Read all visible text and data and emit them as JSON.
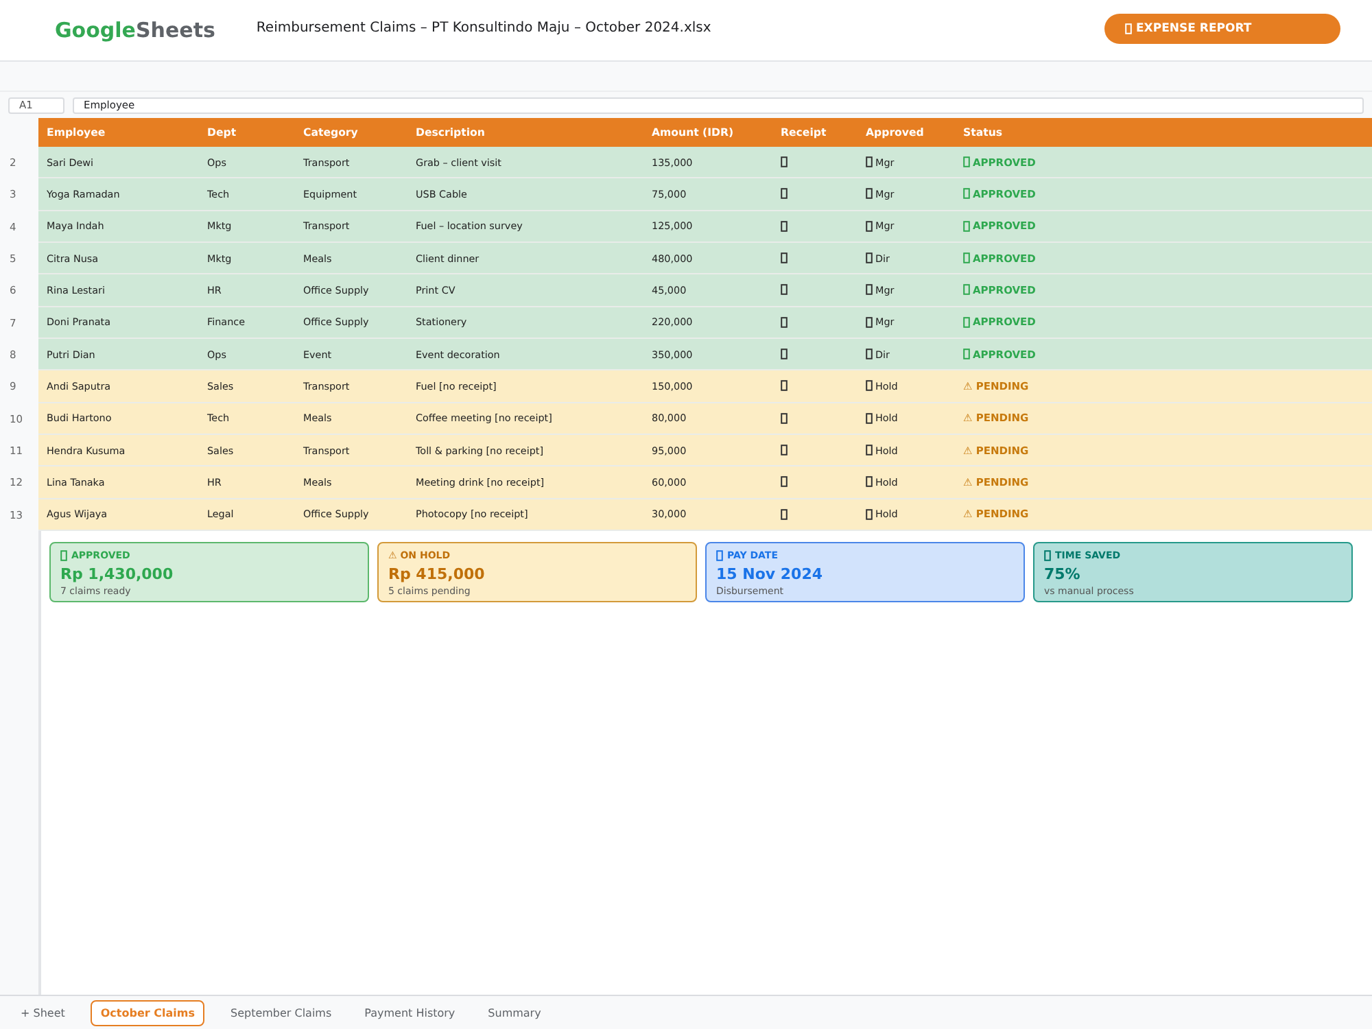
{
  "header": {
    "logo": {
      "brand": "Google",
      "product": "Sheets"
    },
    "file_title": "Reimbursement Claims – PT Konsultindo Maju – October 2024.xlsx",
    "report_button": "EXPENSE REPORT"
  },
  "formula_bar": {
    "cell_ref": "A1",
    "value": "Employee"
  },
  "table": {
    "columns": [
      "Employee",
      "Dept",
      "Category",
      "Description",
      "Amount (IDR)",
      "Receipt",
      "Approved",
      "Status"
    ],
    "rows": [
      {
        "number": "2",
        "kind": "approved",
        "cells": [
          "Sari Dewi",
          "Ops",
          "Transport",
          "Grab – client visit",
          "135,000"
        ],
        "approver": "Mgr",
        "status": "APPROVED"
      },
      {
        "number": "3",
        "kind": "approved",
        "cells": [
          "Yoga Ramadan",
          "Tech",
          "Equipment",
          "USB Cable",
          "75,000"
        ],
        "approver": "Mgr",
        "status": "APPROVED"
      },
      {
        "number": "4",
        "kind": "approved",
        "cells": [
          "Maya Indah",
          "Mktg",
          "Transport",
          "Fuel – location survey",
          "125,000"
        ],
        "approver": "Mgr",
        "status": "APPROVED"
      },
      {
        "number": "5",
        "kind": "approved",
        "cells": [
          "Citra Nusa",
          "Mktg",
          "Meals",
          "Client dinner",
          "480,000"
        ],
        "approver": "Dir",
        "status": "APPROVED"
      },
      {
        "number": "6",
        "kind": "approved",
        "cells": [
          "Rina Lestari",
          "HR",
          "Office Supply",
          "Print CV",
          "45,000"
        ],
        "approver": "Mgr",
        "status": "APPROVED"
      },
      {
        "number": "7",
        "kind": "approved",
        "cells": [
          "Doni Pranata",
          "Finance",
          "Office Supply",
          "Stationery",
          "220,000"
        ],
        "approver": "Mgr",
        "status": "APPROVED"
      },
      {
        "number": "8",
        "kind": "approved",
        "cells": [
          "Putri Dian",
          "Ops",
          "Event",
          "Event decoration",
          "350,000"
        ],
        "approver": "Dir",
        "status": "APPROVED"
      },
      {
        "number": "9",
        "kind": "pending",
        "cells": [
          "Andi Saputra",
          "Sales",
          "Transport",
          "Fuel [no receipt]",
          "150,000"
        ],
        "approver": "Hold",
        "status": "⚠ PENDING"
      },
      {
        "number": "10",
        "kind": "pending",
        "cells": [
          "Budi Hartono",
          "Tech",
          "Meals",
          "Coffee meeting [no receipt]",
          "80,000"
        ],
        "approver": "Hold",
        "status": "⚠ PENDING"
      },
      {
        "number": "11",
        "kind": "pending",
        "cells": [
          "Hendra Kusuma",
          "Sales",
          "Transport",
          "Toll & parking [no receipt]",
          "95,000"
        ],
        "approver": "Hold",
        "status": "⚠ PENDING"
      },
      {
        "number": "12",
        "kind": "pending",
        "cells": [
          "Lina Tanaka",
          "HR",
          "Meals",
          "Meeting drink [no receipt]",
          "60,000"
        ],
        "approver": "Hold",
        "status": "⚠ PENDING"
      },
      {
        "number": "13",
        "kind": "pending",
        "cells": [
          "Agus Wijaya",
          "Legal",
          "Office Supply",
          "Photocopy [no receipt]",
          "30,000"
        ],
        "approver": "Hold",
        "status": "⚠ PENDING"
      }
    ]
  },
  "summary_cards": [
    {
      "kind": "approved",
      "label": "APPROVED",
      "value": "Rp 1,430,000",
      "note": "7 claims ready"
    },
    {
      "kind": "hold",
      "label": "⚠ ON HOLD",
      "value": "Rp 415,000",
      "note": "5 claims pending"
    },
    {
      "kind": "pay",
      "label": "PAY DATE",
      "value": "15 Nov 2024",
      "note": "Disbursement"
    },
    {
      "kind": "saved",
      "label": "TIME SAVED",
      "value": "75%",
      "note": "vs manual process"
    }
  ],
  "sheet_bar": {
    "add_button": "+ Sheet",
    "tabs": [
      {
        "label": "October Claims",
        "selected": true
      },
      {
        "label": "September Claims",
        "selected": false
      },
      {
        "label": "Payment History",
        "selected": false
      },
      {
        "label": "Summary",
        "selected": false
      }
    ]
  }
}
